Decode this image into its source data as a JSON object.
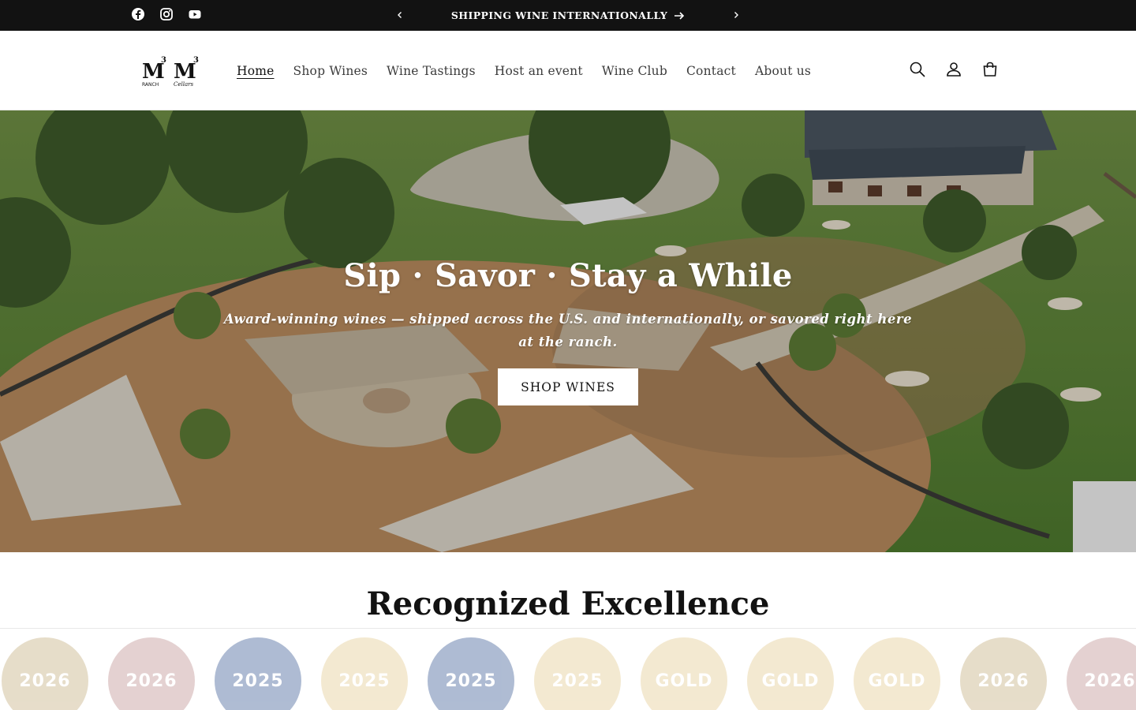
{
  "announcement": {
    "message": "SHIPPING WINE INTERNATIONALLY",
    "social_icons": [
      "facebook-icon",
      "instagram-icon",
      "youtube-icon"
    ]
  },
  "header": {
    "logo_text": {
      "left_mark": "M",
      "left_sup": "3",
      "left_sub": "RANCH",
      "right_mark": "M",
      "right_sup": "3",
      "right_sub": "Cellars"
    },
    "nav": [
      "Home",
      "Shop Wines",
      "Wine Tastings",
      "Host an event",
      "Wine Club",
      "Contact",
      "About us"
    ],
    "active_nav": "Home",
    "icons": [
      "search-icon",
      "account-icon",
      "cart-icon"
    ]
  },
  "hero": {
    "title": "Sip · Savor · Stay a While",
    "subtitle": "Award-winning wines — shipped across the U.S. and internationally, or savored right here at the ranch.",
    "button": "SHOP WINES"
  },
  "recognition": {
    "title": "Recognized Excellence",
    "medals": [
      {
        "label": "2026",
        "color": "#c9b48a"
      },
      {
        "label": "2026",
        "color": "#c49a9a"
      },
      {
        "label": "2025",
        "color": "#4d6a9e"
      },
      {
        "label": "2025",
        "color": "#e6cf9a"
      },
      {
        "label": "2025",
        "color": "#4d6a9e"
      },
      {
        "label": "2025",
        "color": "#e6cf9a"
      },
      {
        "label": "GOLD",
        "color": "#e6cf9a"
      },
      {
        "label": "GOLD",
        "color": "#e6cf9a"
      },
      {
        "label": "GOLD",
        "color": "#e6cf9a"
      },
      {
        "label": "2026",
        "color": "#c9b48a"
      },
      {
        "label": "2026",
        "color": "#c49a9a"
      }
    ]
  },
  "colors": {
    "announcement_bg": "#121212",
    "text": "#121212",
    "nav_text": "#3c3c3c",
    "button_bg": "#ffffff"
  }
}
